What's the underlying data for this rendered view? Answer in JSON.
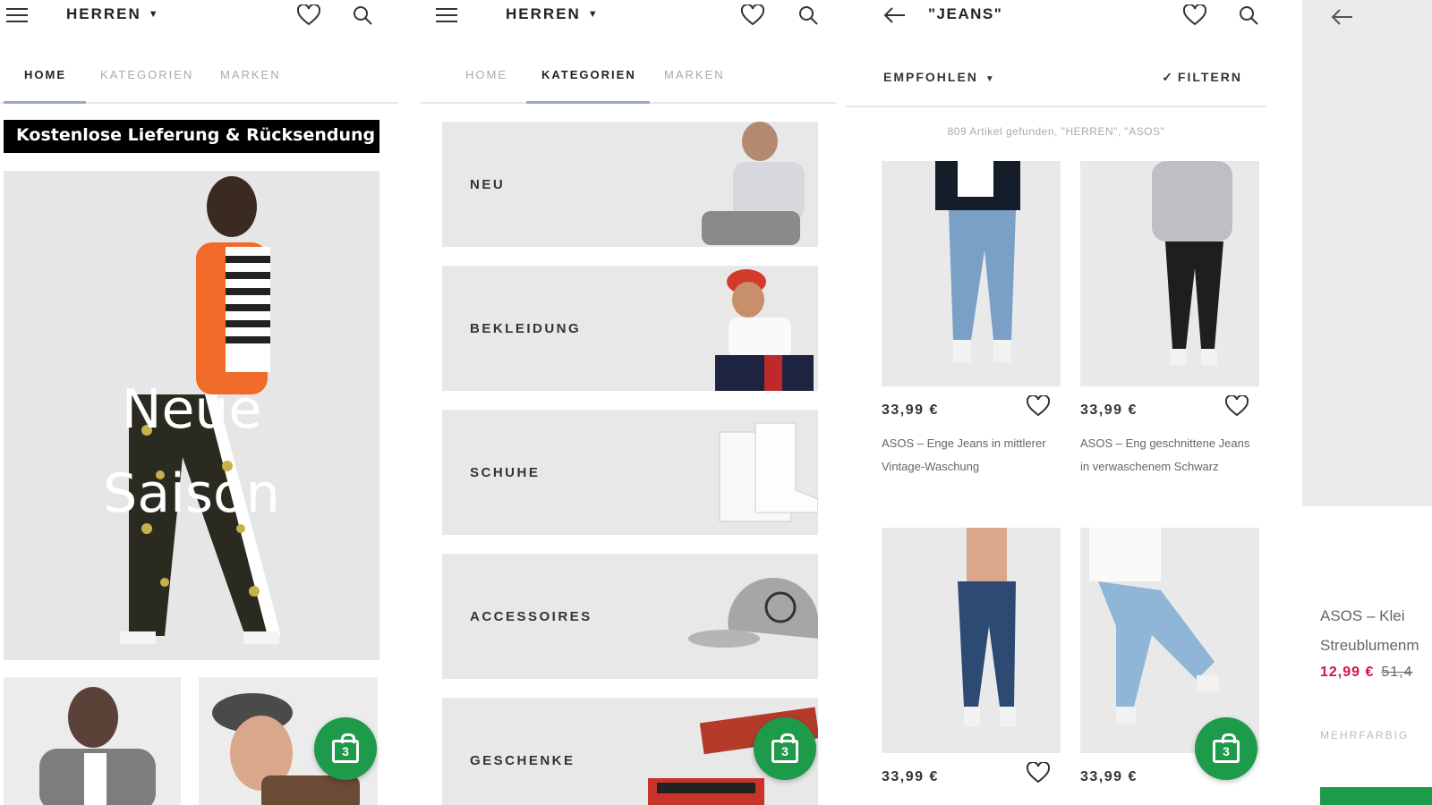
{
  "colors": {
    "accent_green": "#1d9a4a",
    "sale_red": "#d01345",
    "tab_underline": "#9aa8c8"
  },
  "screen1": {
    "menu_icon": "hamburger-icon",
    "title": "HERREN",
    "tabs": [
      "HOME",
      "KATEGORIEN",
      "MARKEN"
    ],
    "promo": "Kostenlose Lieferung & Rücksendung",
    "hero_line1": "Neue",
    "hero_line2": "Saison",
    "bag_count": "3"
  },
  "screen2": {
    "title": "HERREN",
    "tabs": [
      "HOME",
      "KATEGORIEN",
      "MARKEN"
    ],
    "categories": [
      "NEU",
      "BEKLEIDUNG",
      "SCHUHE",
      "ACCESSOIRES",
      "GESCHENKE"
    ],
    "bag_count": "3"
  },
  "screen3": {
    "title": "\"JEANS\"",
    "sort_label": "EMPFOHLEN",
    "filter_label": "FILTERN",
    "results": "809 Artikel gefunden, \"HERREN\", \"ASOS\"",
    "products": [
      {
        "price": "33,99 €",
        "name": "ASOS – Enge Jeans in mittlerer Vintage-Waschung"
      },
      {
        "price": "33,99 €",
        "name": "ASOS – Eng geschnittene Jeans in verwaschenem Schwarz"
      },
      {
        "price": "33,99 €",
        "name": ""
      },
      {
        "price": "33,99 €",
        "name": ""
      }
    ],
    "bag_count": "3"
  },
  "screen4": {
    "name_line1": "ASOS – Klei",
    "name_line2": "Streublumenm",
    "price": "12,99 €",
    "old_price": "51,4",
    "color_label": "MEHRFARBIG"
  }
}
